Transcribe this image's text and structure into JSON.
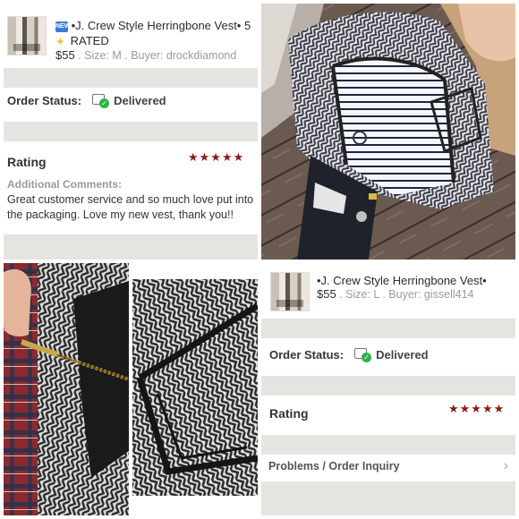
{
  "order1": {
    "new_badge": "NEW",
    "title": "•J. Crew Style Herringbone Vest• 5",
    "title_line2": "RATED",
    "price": "$55",
    "meta": " . Size: M . Buyer: drockdiamond",
    "status_label": "Order Status:",
    "status_value": "Delivered",
    "rating_label": "Rating",
    "stars": "★★★★★",
    "comments_title": "Additional Comments:",
    "comments": "Great customer service and so much love put into the packaging. Love my new vest, thank you!!"
  },
  "order2": {
    "title": "•J. Crew Style Herringbone Vest•",
    "price": "$55",
    "meta": " . Size: L . Buyer: gissell414",
    "status_label": "Order Status:",
    "status_value": "Delivered",
    "rating_label": "Rating",
    "stars": "★★★★★",
    "problems_label": "Problems / Order Inquiry",
    "chevron": "›"
  },
  "colors": {
    "star": "#8b1a1a",
    "delivered_check": "#2fb14a",
    "separator": "#e6e4e1"
  }
}
